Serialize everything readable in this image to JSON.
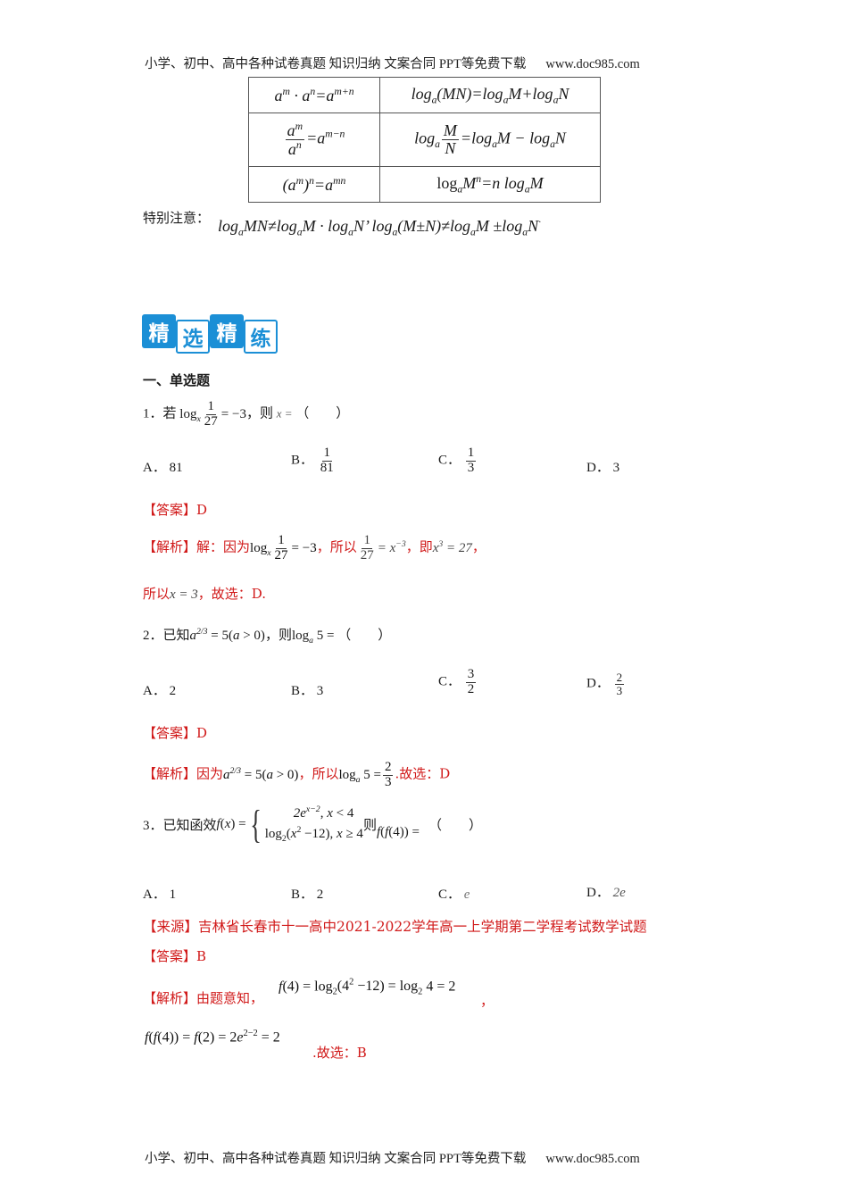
{
  "page_header": {
    "left": "小学、初中、高中各种试卷真题 知识归纳 文案合同 PPT等免费下载",
    "right": "www.doc985.com"
  },
  "page_footer": {
    "left": "小学、初中、高中各种试卷真题 知识归纳 文案合同 PPT等免费下载",
    "right": "www.doc985.com"
  },
  "formula_table": {
    "rows": [
      {
        "power": "a^m · a^n = a^(m+n)",
        "log": "log_a(MN) = log_a M + log_a N"
      },
      {
        "power": "a^m / a^n = a^(m−n)",
        "log": "log_a (M/N) = log_a M − log_a N"
      },
      {
        "power": "(a^m)^n = a^(mn)",
        "log": "log_a M^n = n log_a M"
      }
    ]
  },
  "special_note": {
    "label": "特别注意：",
    "text": "log_a MN ≠ log_a M · log_a N，log_a(M ± N) ≠ log_a M ± log_a N"
  },
  "banner": {
    "chars": [
      "精",
      "选",
      "精",
      "练"
    ],
    "color": "#1b8fd6"
  },
  "section_title": "一、单选题",
  "questions": [
    {
      "number": "1．",
      "stem_prefix": "若",
      "stem_suffix": "，则",
      "blank": "（　　）",
      "options": [
        {
          "label": "A．",
          "value": "81"
        },
        {
          "label": "B．",
          "value": "1/81"
        },
        {
          "label": "C．",
          "value": "1/3"
        },
        {
          "label": "D．",
          "value": "3"
        }
      ],
      "answer_label": "【答案】",
      "answer": "D",
      "analysis_label": "【解析】",
      "analysis_lines": [
        "解：因为",
        "，所以",
        "，即",
        "，",
        "所以",
        "，故选：D."
      ]
    },
    {
      "number": "2．",
      "stem_prefix": "已知",
      "stem_suffix": "，则",
      "blank": "（　　）",
      "options": [
        {
          "label": "A．",
          "value": "2"
        },
        {
          "label": "B．",
          "value": "3"
        },
        {
          "label": "C．",
          "value": "3/2"
        },
        {
          "label": "D．",
          "value": "2/3"
        }
      ],
      "answer_label": "【答案】",
      "answer": "D",
      "analysis_label": "【解析】",
      "analysis_lines": [
        "因为",
        "，所以",
        ".故选：D"
      ]
    },
    {
      "number": "3．",
      "stem_prefix": "已知函效",
      "stem_suffix": "则",
      "blank": "（　　）",
      "options": [
        {
          "label": "A．",
          "value": "1"
        },
        {
          "label": "B．",
          "value": "2"
        },
        {
          "label": "C．",
          "value": "e"
        },
        {
          "label": "D．",
          "value": "2e"
        }
      ],
      "source_label": "【来源】",
      "source": "吉林省长春市十一高中2021-2022学年高一上学期第二学程考试数学试题",
      "answer_label": "【答案】",
      "answer": "B",
      "analysis_label": "【解析】",
      "analysis_lines": [
        "由题意知，",
        "，",
        ".故选：B"
      ]
    }
  ],
  "colors": {
    "accent_red": "#d11a1a",
    "banner_blue": "#1b8fd6"
  }
}
